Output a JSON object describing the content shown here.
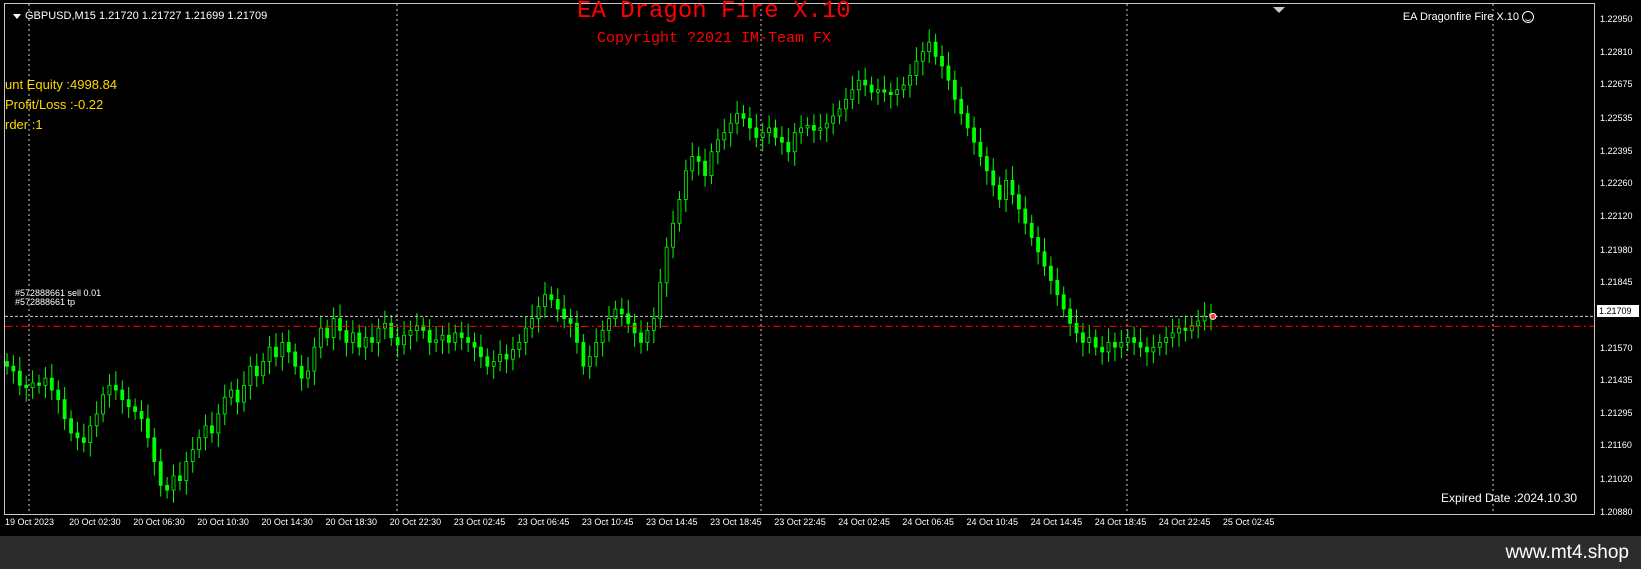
{
  "chart": {
    "symbol_line": "GBPUSD,M15  1.21720 1.21727 1.21699 1.21709",
    "ea_title": "EA Dragon Fire X.10",
    "ea_copyright": "Copyright ?2021 IM-Team FX",
    "ea_name": "EA Dragonfire Fire X.10",
    "info_lines": [
      "unt Equity :4998.84",
      "Profit/Loss :-0.22",
      "rder :1"
    ],
    "order_labels": [
      "#572888661 sell 0.01",
      "#572888661 tp"
    ],
    "expired": "Expired Date :2024.10.30",
    "current_price": "1.21709",
    "price_levels": [
      "1.22950",
      "1.22810",
      "1.22675",
      "1.22535",
      "1.22395",
      "1.22260",
      "1.22120",
      "1.21980",
      "1.21845",
      "1.21570",
      "1.21435",
      "1.21295",
      "1.21160",
      "1.21020",
      "1.20880"
    ],
    "time_labels": [
      "19 Oct 2023",
      "20 Oct 02:30",
      "20 Oct 06:30",
      "20 Oct 10:30",
      "20 Oct 14:30",
      "20 Oct 18:30",
      "20 Oct 22:30",
      "23 Oct 02:45",
      "23 Oct 06:45",
      "23 Oct 10:45",
      "23 Oct 14:45",
      "23 Oct 18:45",
      "23 Oct 22:45",
      "24 Oct 02:45",
      "24 Oct 06:45",
      "24 Oct 10:45",
      "24 Oct 14:45",
      "24 Oct 18:45",
      "24 Oct 22:45",
      "25 Oct 02:45"
    ],
    "colors": {
      "bull": "#00ff00",
      "bear": "#00ff00",
      "grid": "#d0d0d0",
      "tp": "#ff0000",
      "order": "#c8c8c8",
      "ea": "#ff0000",
      "info": "#ffd700"
    }
  },
  "chart_data": {
    "type": "candlestick",
    "ylim": [
      1.2088,
      1.2302
    ],
    "close": [
      1.215,
      1.2148,
      1.2142,
      1.2141,
      1.2143,
      1.2142,
      1.2145,
      1.214,
      1.2136,
      1.2128,
      1.2122,
      1.212,
      1.2118,
      1.2125,
      1.213,
      1.2138,
      1.2142,
      1.214,
      1.2136,
      1.2133,
      1.2131,
      1.2128,
      1.212,
      1.211,
      1.21,
      1.2098,
      1.2104,
      1.2102,
      1.211,
      1.2115,
      1.212,
      1.2125,
      1.2122,
      1.213,
      1.2137,
      1.214,
      1.2135,
      1.2142,
      1.215,
      1.2146,
      1.2152,
      1.2158,
      1.2154,
      1.216,
      1.2156,
      1.215,
      1.2145,
      1.2148,
      1.2158,
      1.2166,
      1.2162,
      1.217,
      1.2165,
      1.216,
      1.2164,
      1.2158,
      1.2162,
      1.216,
      1.2166,
      1.2168,
      1.2162,
      1.2159,
      1.2163,
      1.2165,
      1.2167,
      1.2165,
      1.216,
      1.2161,
      1.2163,
      1.216,
      1.2164,
      1.2162,
      1.216,
      1.2158,
      1.2154,
      1.215,
      1.2152,
      1.2155,
      1.2153,
      1.2157,
      1.216,
      1.2166,
      1.217,
      1.2175,
      1.218,
      1.2178,
      1.2174,
      1.217,
      1.2168,
      1.216,
      1.215,
      1.2154,
      1.216,
      1.2165,
      1.217,
      1.2174,
      1.2172,
      1.2168,
      1.2164,
      1.216,
      1.2165,
      1.217,
      1.2185,
      1.22,
      1.221,
      1.222,
      1.2232,
      1.2238,
      1.2236,
      1.223,
      1.224,
      1.2245,
      1.2248,
      1.2252,
      1.2256,
      1.2254,
      1.225,
      1.2246,
      1.2248,
      1.225,
      1.2246,
      1.2244,
      1.224,
      1.2248,
      1.225,
      1.2251,
      1.2249,
      1.225,
      1.2252,
      1.2255,
      1.2258,
      1.2262,
      1.2266,
      1.227,
      1.2268,
      1.2265,
      1.2266,
      1.2265,
      1.2264,
      1.2266,
      1.2268,
      1.2272,
      1.2278,
      1.2282,
      1.2286,
      1.228,
      1.2276,
      1.227,
      1.2262,
      1.2256,
      1.225,
      1.2244,
      1.2238,
      1.2232,
      1.2226,
      1.222,
      1.2228,
      1.2222,
      1.2216,
      1.221,
      1.2204,
      1.2198,
      1.2192,
      1.2186,
      1.218,
      1.2174,
      1.2168,
      1.2164,
      1.216,
      1.2162,
      1.2158,
      1.2156,
      1.216,
      1.2158,
      1.216,
      1.2162,
      1.216,
      1.2158,
      1.2156,
      1.2158,
      1.216,
      1.2162,
      1.2164,
      1.2166,
      1.2165,
      1.2167,
      1.2169,
      1.2171,
      1.2172
    ]
  }
}
